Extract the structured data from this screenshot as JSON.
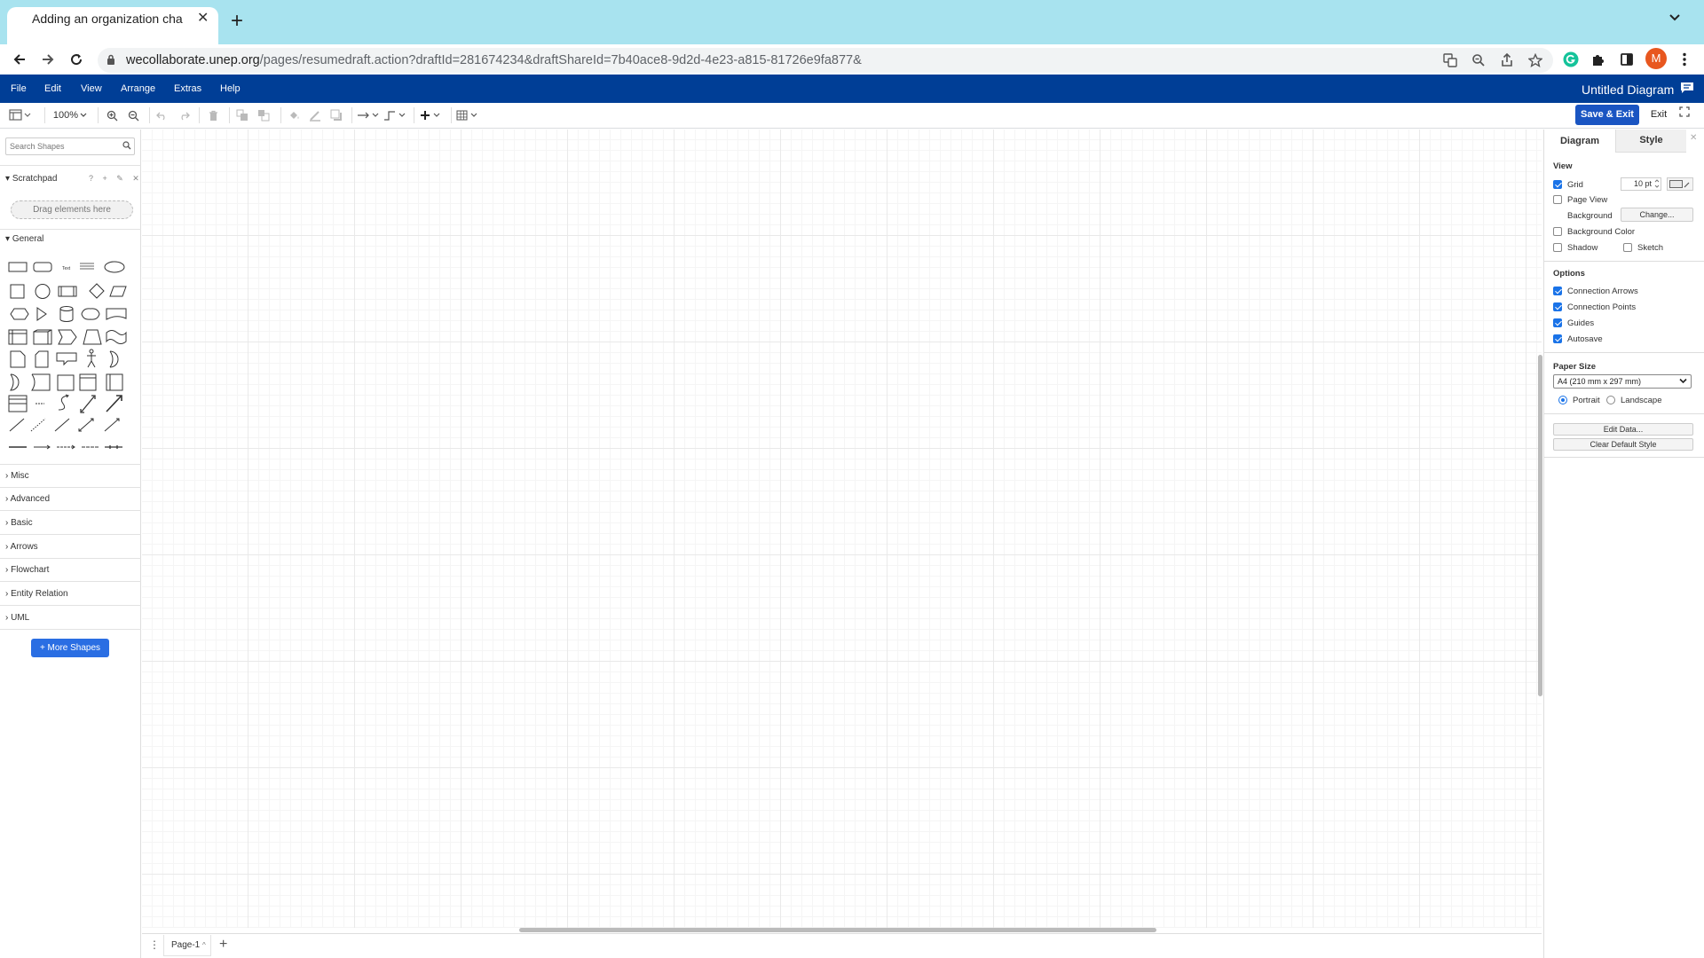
{
  "browser": {
    "tab_title": "Adding an organization chart",
    "tab_title_fade": "\\",
    "url_host": "wecollaborate.unep.org",
    "url_path": "/pages/resumedraft.action?draftId=281674234&draftShareId=7b40ace8-9d2d-4e23-a815-81726e9fa877&",
    "avatar_letter": "M"
  },
  "menubar": {
    "items": [
      "File",
      "Edit",
      "View",
      "Arrange",
      "Extras",
      "Help"
    ],
    "diagram_title": "Untitled Diagram"
  },
  "toolbar": {
    "zoom": "100%",
    "save_exit": "Save & Exit",
    "exit": "Exit"
  },
  "sidebar": {
    "search_placeholder": "Search Shapes",
    "scratchpad": "Scratchpad",
    "scratchpad_tools": "? + ✎ ✕",
    "drop_hint": "Drag elements here",
    "general": "General",
    "categories": [
      "Misc",
      "Advanced",
      "Basic",
      "Arrows",
      "Flowchart",
      "Entity Relation",
      "UML"
    ],
    "more_shapes": "+ More Shapes"
  },
  "pages": {
    "current": "Page-1"
  },
  "format_panel": {
    "tabs": [
      "Diagram",
      "Style"
    ],
    "view_heading": "View",
    "grid": {
      "label": "Grid",
      "checked": true,
      "size": "10 pt"
    },
    "page_view": {
      "label": "Page View",
      "checked": false
    },
    "background": {
      "label": "Background",
      "button": "Change..."
    },
    "background_color": {
      "label": "Background Color",
      "checked": false
    },
    "shadow": {
      "label": "Shadow",
      "checked": false
    },
    "sketch": {
      "label": "Sketch",
      "checked": false
    },
    "options_heading": "Options",
    "options": [
      {
        "label": "Connection Arrows",
        "checked": true
      },
      {
        "label": "Connection Points",
        "checked": true
      },
      {
        "label": "Guides",
        "checked": true
      },
      {
        "label": "Autosave",
        "checked": true
      }
    ],
    "paper_heading": "Paper Size",
    "paper_size": "A4 (210 mm x 297 mm)",
    "portrait": "Portrait",
    "landscape": "Landscape",
    "edit_data": "Edit Data...",
    "clear_style": "Clear Default Style"
  },
  "colors": {
    "menubar": "#003e96",
    "tabbar": "#a8e3ef",
    "primary_button": "#1a55c2",
    "more_shapes": "#2a6ee3"
  }
}
